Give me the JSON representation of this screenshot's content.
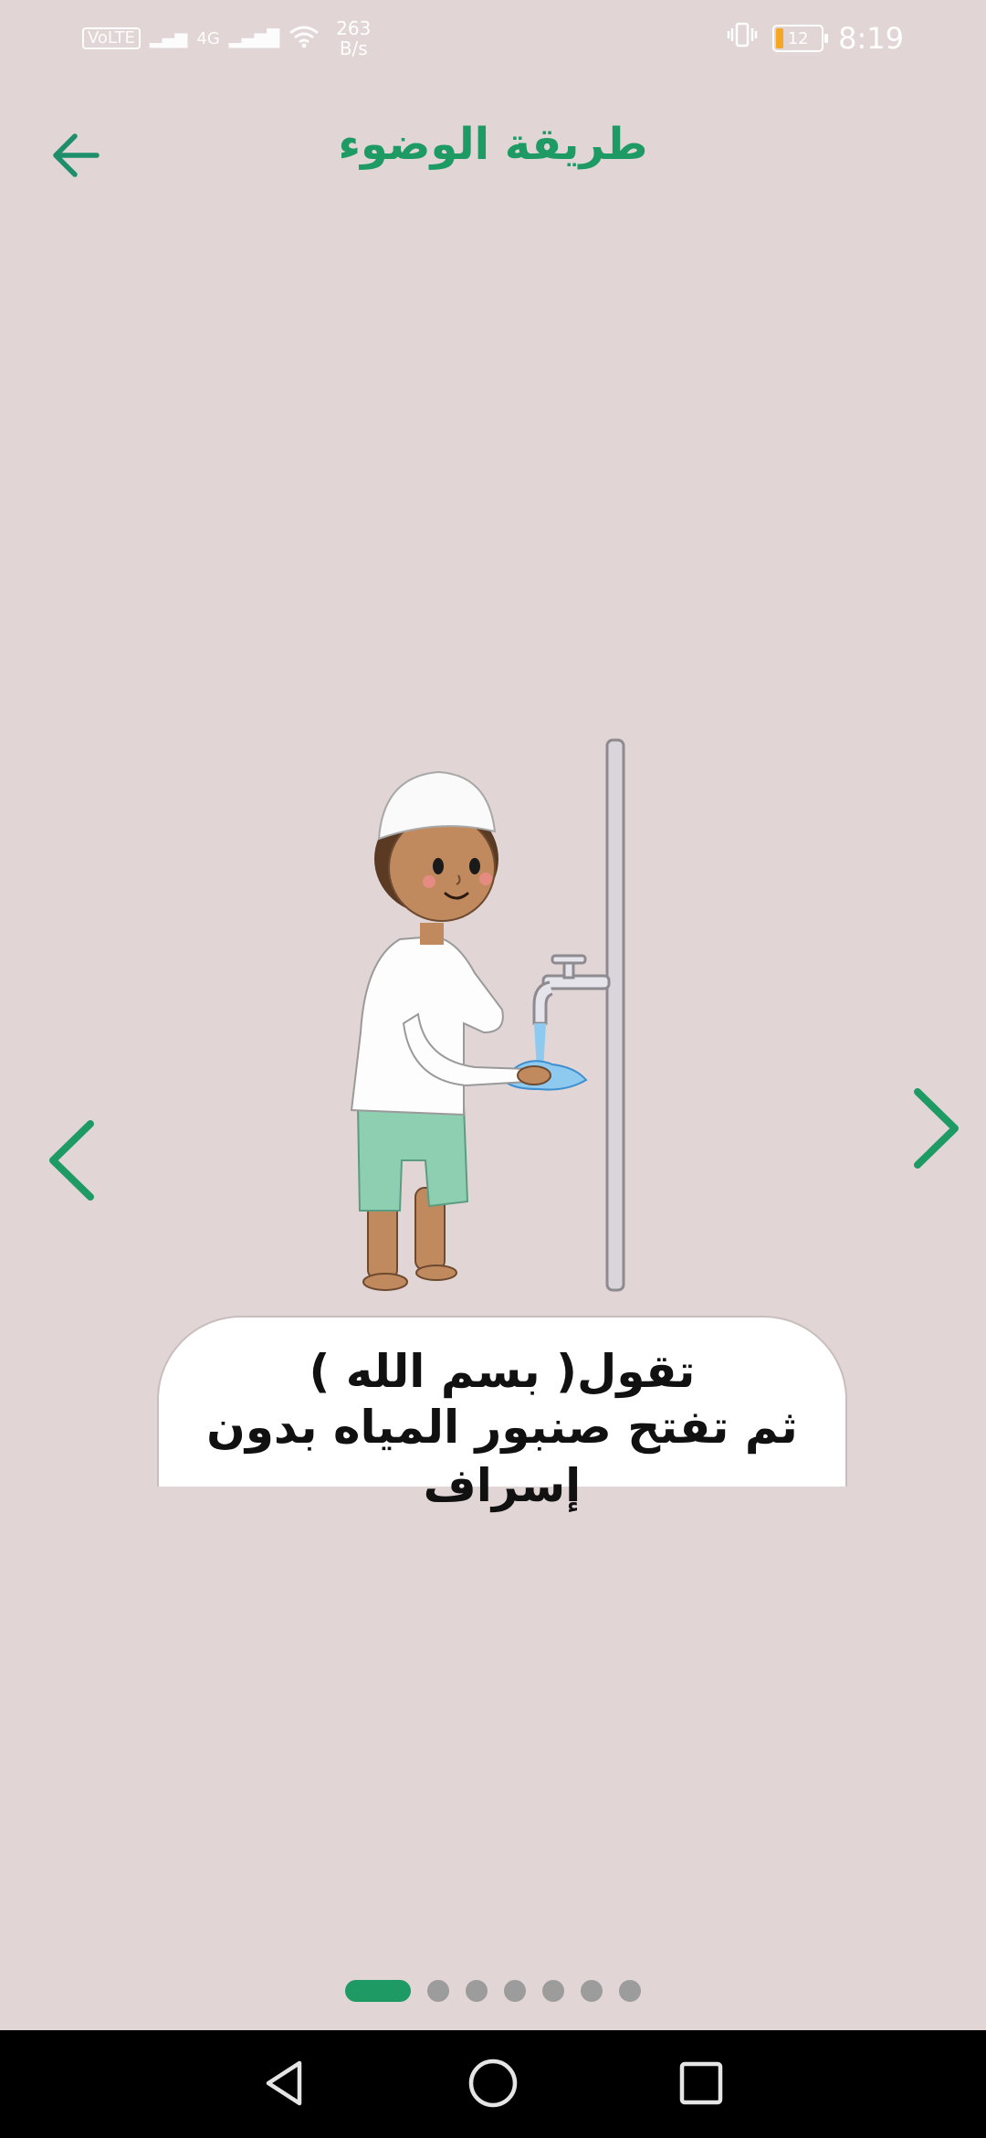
{
  "status_bar": {
    "volte": "VoLTE",
    "net_type": "4G",
    "speed_value": "263",
    "speed_unit": "B/s",
    "battery_level": "12",
    "time": "8:19"
  },
  "header": {
    "title": "طريقة الوضوء"
  },
  "slide": {
    "caption_line1": "تقول( بسم الله )",
    "caption_line2": "ثم تفتح صنبور المياه بدون إسراف"
  },
  "pager": {
    "count": 7,
    "active_index": 0
  },
  "colors": {
    "accent": "#1e9b64",
    "background": "#e1d5d5"
  }
}
